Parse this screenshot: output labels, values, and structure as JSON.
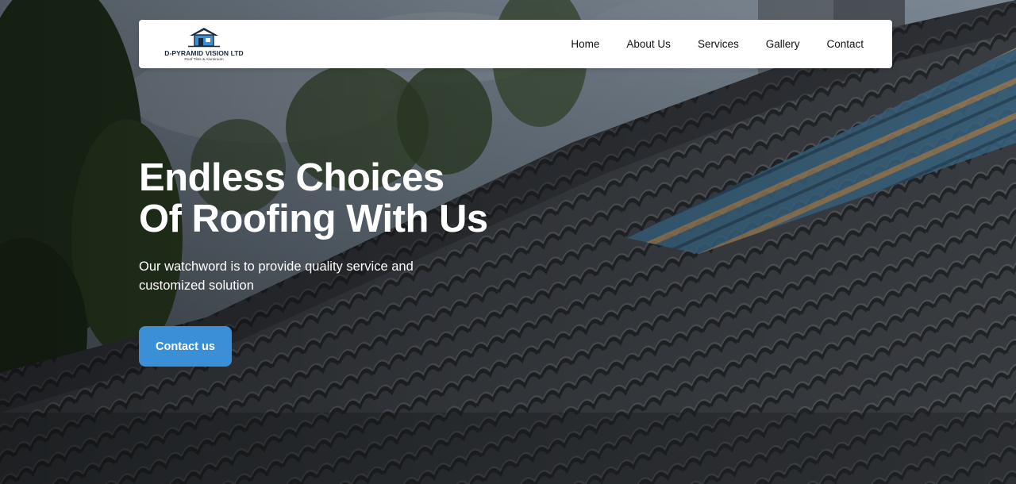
{
  "brand": {
    "name": "D-PYRAMID VISION LTD",
    "tagline": "Roof Tiles & Aluminium",
    "logo_icon": "house-roof-icon"
  },
  "nav": {
    "items": [
      {
        "label": "Home"
      },
      {
        "label": "About Us"
      },
      {
        "label": "Services"
      },
      {
        "label": "Gallery"
      },
      {
        "label": "Contact"
      }
    ]
  },
  "hero": {
    "headline_line1": "Endless Choices",
    "headline_line2": "Of Roofing With Us",
    "subtext": "Our watchword is to provide quality service and customized solution",
    "cta_label": "Contact us",
    "background": "roof-tiles-photo"
  },
  "colors": {
    "accent": "#3a8fd6",
    "navbar_bg": "#ffffff",
    "headline_text": "#ffffff"
  }
}
